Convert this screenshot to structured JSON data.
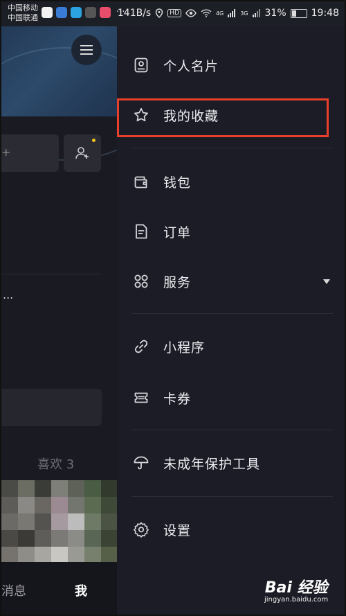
{
  "status_bar": {
    "carrier_1": "中国移动",
    "carrier_2": "中国联通",
    "dots": "···",
    "speed": "141B/s",
    "hd": "HD",
    "net1": "4G",
    "net2": "3G",
    "battery": "31%",
    "time": "19:48"
  },
  "left_panel": {
    "input_char": "+",
    "ellipsis": "...",
    "likes_label": "喜欢 3",
    "tabs": {
      "messages": "消息",
      "me": "我"
    }
  },
  "drawer": {
    "items": [
      {
        "label": "个人名片",
        "icon": "profile-card-icon"
      },
      {
        "label": "我的收藏",
        "icon": "star-icon"
      },
      {
        "label": "钱包",
        "icon": "wallet-icon"
      },
      {
        "label": "订单",
        "icon": "order-icon"
      },
      {
        "label": "服务",
        "icon": "services-icon"
      },
      {
        "label": "小程序",
        "icon": "mini-program-icon"
      },
      {
        "label": "卡券",
        "icon": "coupon-icon"
      },
      {
        "label": "未成年保护工具",
        "icon": "umbrella-icon"
      },
      {
        "label": "设置",
        "icon": "gear-icon"
      }
    ],
    "highlight_color": "#e8402a"
  },
  "watermark": {
    "main": "Bai 经验",
    "sub": "jingyan.baidu.com"
  }
}
